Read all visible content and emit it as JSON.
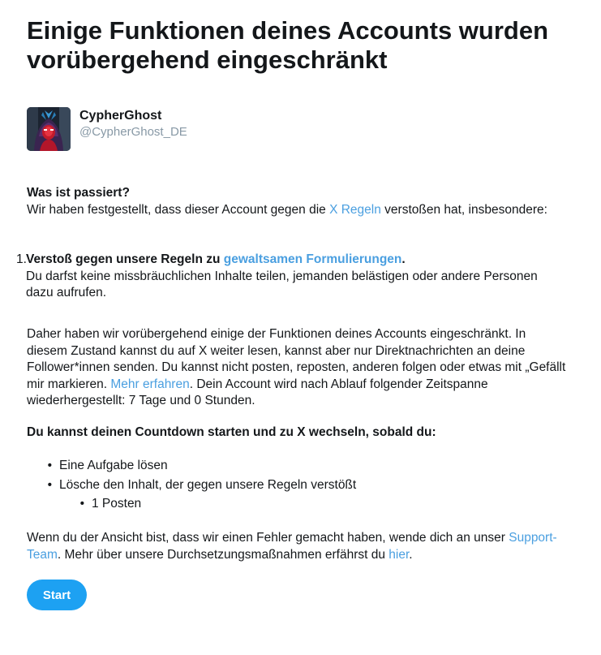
{
  "title": "Einige Funktionen deines Accounts wurden vorübergehend eingeschränkt",
  "account": {
    "display_name": "CypherGhost",
    "handle": "@CypherGhost_DE",
    "avatar_icon": "hooded-figure-avatar"
  },
  "what_happened": {
    "heading": "Was ist passiert?",
    "text_before_link": "Wir haben festgestellt, dass dieser Account gegen die ",
    "rules_link": "X Regeln",
    "text_after_link": " verstoßen hat, insbesondere:"
  },
  "violation": {
    "number": "1.",
    "title_before_link": "Verstoß gegen unsere Regeln zu ",
    "title_link": "gewaltsamen Formulierungen",
    "title_after_link": ".",
    "description": "Du darfst keine missbräuchlichen Inhalte teilen, jemanden belästigen oder andere Personen dazu aufrufen."
  },
  "therefore": {
    "text_before_link": "Daher haben wir vorübergehend einige der Funktionen deines Accounts eingeschränkt. In diesem Zustand kannst du auf X weiter lesen, kannst aber nur Direktnachrichten an deine Follower*innen senden. Du kannst nicht posten, reposten, anderen folgen oder etwas mit „Gefällt mir markieren. ",
    "learn_more_link": "Mehr erfahren",
    "text_after_link": ". Dein Account wird nach Ablauf folgender Zeitspanne wiederhergestellt: 7 Tage und 0 Stunden."
  },
  "countdown": {
    "heading": "Du kannst deinen Countdown starten und zu X wechseln, sobald du:",
    "tasks": [
      "Eine Aufgabe lösen",
      "Lösche den Inhalt, der gegen unsere Regeln verstößt"
    ],
    "subtasks": [
      "1 Posten"
    ]
  },
  "contact": {
    "text_before_support": "Wenn du der Ansicht bist, dass wir einen Fehler gemacht haben, wende dich an unser ",
    "support_link": "Support-Team",
    "text_middle": ". Mehr über unsere Durchsetzungsmaßnahmen erfährst du ",
    "here_link": "hier",
    "text_end": "."
  },
  "start_button": {
    "label": "Start",
    "color": "#1da1f2"
  },
  "colors": {
    "link": "#4a9fe0",
    "text": "#14171a",
    "handle": "#8899a6"
  }
}
